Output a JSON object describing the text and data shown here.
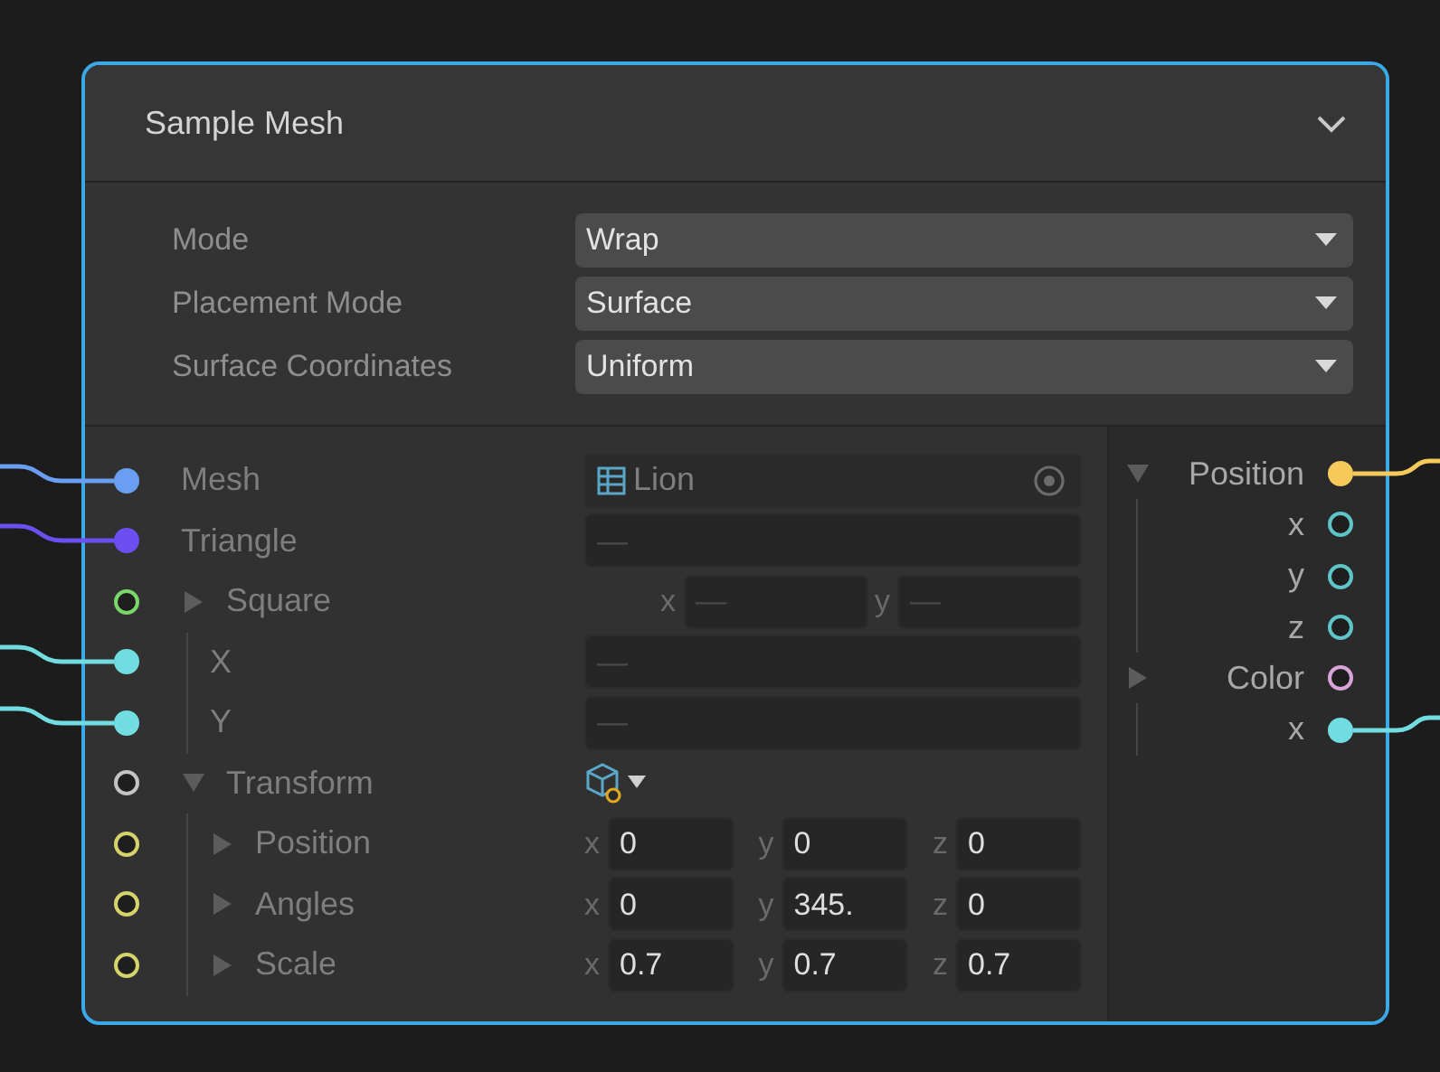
{
  "node": {
    "title": "Sample Mesh",
    "collapsed": false
  },
  "settings": [
    {
      "label": "Mode",
      "value": "Wrap"
    },
    {
      "label": "Placement Mode",
      "value": "Surface"
    },
    {
      "label": "Surface Coordinates",
      "value": "Uniform"
    }
  ],
  "inputs": [
    {
      "label": "Mesh",
      "port": {
        "color": "#6b9ef0",
        "filled": true,
        "connected": true
      },
      "field": {
        "kind": "object",
        "value": "Lion"
      }
    },
    {
      "label": "Triangle",
      "port": {
        "color": "#6c4ff0",
        "filled": true,
        "connected": true
      },
      "field": {
        "kind": "text",
        "value": "—"
      }
    },
    {
      "label": "Square",
      "port": {
        "color": "#7bd66b",
        "filled": false,
        "connected": false
      },
      "expanded": false,
      "field": {
        "kind": "vector",
        "components": [
          {
            "axis": "x",
            "value": "—"
          },
          {
            "axis": "y",
            "value": "—"
          }
        ]
      },
      "children": [
        {
          "label": "X",
          "port": {
            "color": "#72dde0",
            "filled": true,
            "connected": true
          },
          "field": {
            "kind": "text",
            "value": "—"
          }
        },
        {
          "label": "Y",
          "port": {
            "color": "#72dde0",
            "filled": true,
            "connected": true
          },
          "field": {
            "kind": "text",
            "value": "—"
          }
        }
      ]
    },
    {
      "label": "Transform",
      "port": {
        "color": "#c4c4c4",
        "filled": false,
        "connected": false
      },
      "expanded": true,
      "field": {
        "kind": "space"
      },
      "children": [
        {
          "label": "Position",
          "port": {
            "color": "#d4d46a",
            "filled": false,
            "connected": false
          },
          "expanded": false,
          "field": {
            "kind": "vector",
            "components": [
              {
                "axis": "x",
                "value": "0"
              },
              {
                "axis": "y",
                "value": "0"
              },
              {
                "axis": "z",
                "value": "0"
              }
            ]
          }
        },
        {
          "label": "Angles",
          "port": {
            "color": "#d4d46a",
            "filled": false,
            "connected": false
          },
          "expanded": false,
          "field": {
            "kind": "vector",
            "components": [
              {
                "axis": "x",
                "value": "0"
              },
              {
                "axis": "y",
                "value": "345."
              },
              {
                "axis": "z",
                "value": "0"
              }
            ]
          }
        },
        {
          "label": "Scale",
          "port": {
            "color": "#d4d46a",
            "filled": false,
            "connected": false
          },
          "expanded": false,
          "field": {
            "kind": "vector",
            "components": [
              {
                "axis": "x",
                "value": "0.7"
              },
              {
                "axis": "y",
                "value": "0.7"
              },
              {
                "axis": "z",
                "value": "0.7"
              }
            ]
          }
        }
      ]
    }
  ],
  "outputs": [
    {
      "label": "Position",
      "port": {
        "color": "#f5c95a",
        "filled": true,
        "connected": true
      },
      "expanded": true,
      "children": [
        {
          "label": "x",
          "port": {
            "color": "#5fc4c8",
            "filled": false,
            "connected": false
          }
        },
        {
          "label": "y",
          "port": {
            "color": "#5fc4c8",
            "filled": false,
            "connected": false
          }
        },
        {
          "label": "z",
          "port": {
            "color": "#5fc4c8",
            "filled": false,
            "connected": false
          }
        }
      ]
    },
    {
      "label": "Color",
      "port": {
        "color": "#d9a5d9",
        "filled": false,
        "connected": false
      },
      "expanded": false,
      "children": [
        {
          "label": "x",
          "port": {
            "color": "#72dde0",
            "filled": true,
            "connected": true
          }
        }
      ]
    }
  ]
}
